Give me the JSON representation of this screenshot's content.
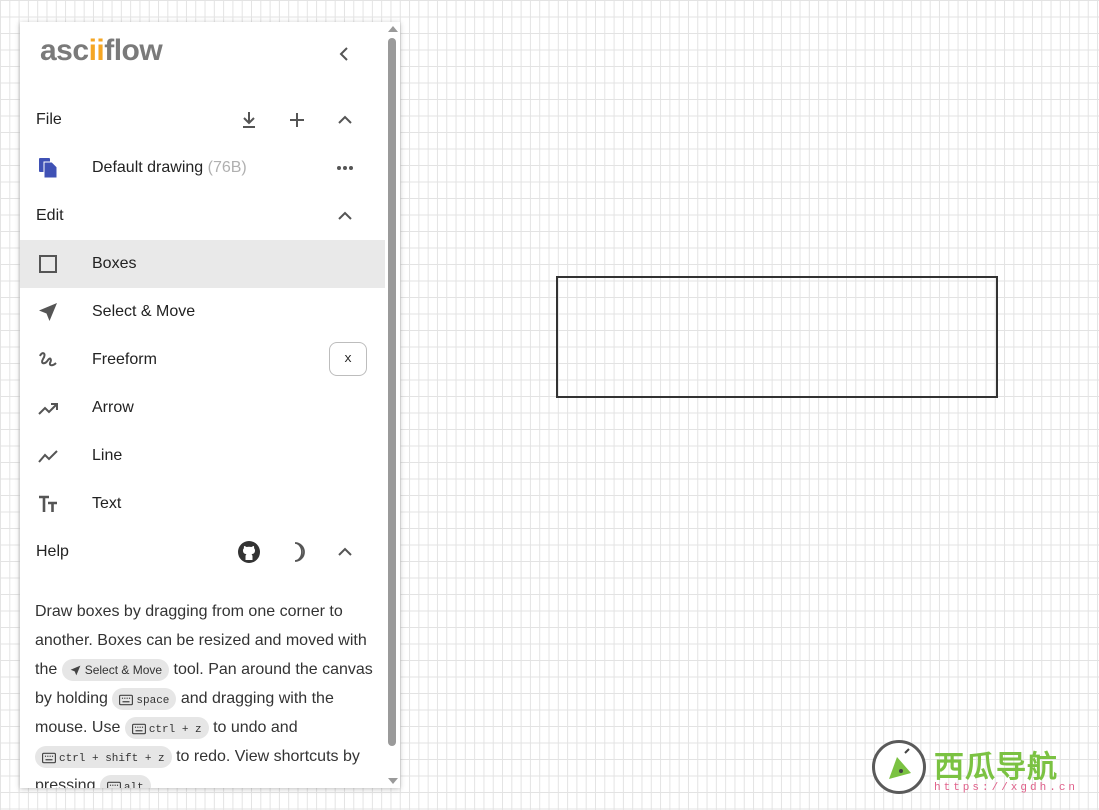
{
  "app": {
    "logo_text_a": "asc",
    "logo_text_ii": "ii",
    "logo_text_b": "flow"
  },
  "file_section": {
    "title": "File"
  },
  "drawing": {
    "name": "Default drawing",
    "size": "(76B)"
  },
  "edit_section": {
    "title": "Edit"
  },
  "tools": [
    {
      "label": "Boxes",
      "icon": "square-outline-icon",
      "selected": true
    },
    {
      "label": "Select & Move",
      "icon": "navigation-arrow-icon"
    },
    {
      "label": "Freeform",
      "icon": "gesture-icon",
      "shortcut": "x"
    },
    {
      "label": "Arrow",
      "icon": "trending-up-icon"
    },
    {
      "label": "Line",
      "icon": "show-chart-icon"
    },
    {
      "label": "Text",
      "icon": "text-fields-icon"
    }
  ],
  "help_section": {
    "title": "Help"
  },
  "help": {
    "p1": "Draw boxes by dragging from one corner to another. Boxes can be resized and moved with the ",
    "chip_select": "Select & Move",
    "p2": " tool. Pan around the canvas by holding ",
    "chip_space": "space",
    "p3": " and dragging with the mouse. Use ",
    "chip_undo": "ctrl + z",
    "p4": " to undo and ",
    "chip_redo": "ctrl + shift + z",
    "p5": " to redo. View shortcuts by pressing ",
    "chip_alt": "alt",
    "p6": "."
  },
  "watermark": {
    "title": "西瓜导航",
    "url": "https://xgdh.cn"
  },
  "colors": {
    "accent_logo": "#f5a623",
    "file_icon": "#3f51b5",
    "selected_row": "#e9e9e9"
  }
}
